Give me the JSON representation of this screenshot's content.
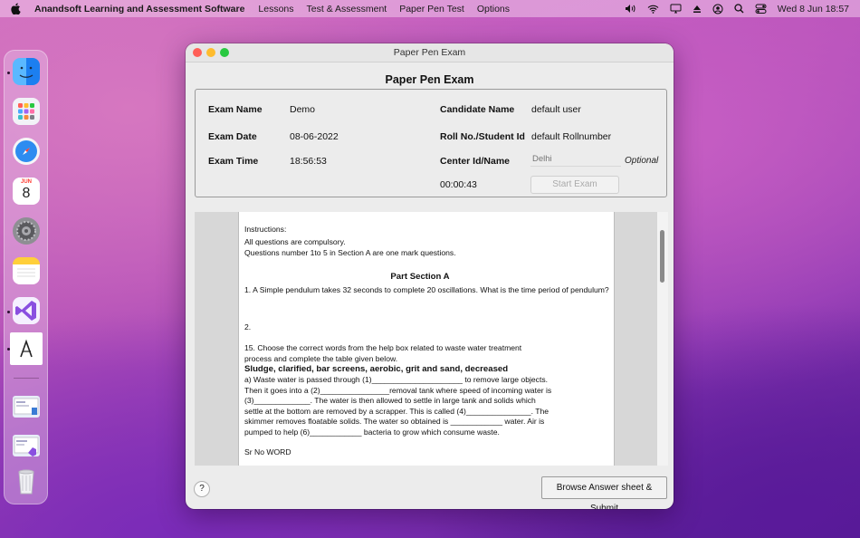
{
  "menubar": {
    "app_name": "Anandsoft Learning and Assessment Software",
    "menus": [
      "Lessons",
      "Test & Assessment",
      "Paper Pen Test",
      "Options"
    ],
    "clock": "Wed 8 Jun  18:57",
    "status_icons": [
      "volume-icon",
      "wifi-icon",
      "display-icon",
      "eject-icon",
      "user-icon",
      "search-icon",
      "control-center-icon"
    ]
  },
  "dock": {
    "apps": [
      "Finder",
      "Launchpad",
      "Safari",
      "Calendar",
      "System Preferences",
      "Notes",
      "Visual Studio",
      "Anandsoft",
      "Preview",
      "Window",
      "Trash"
    ],
    "calendar": {
      "month": "JUN",
      "day": "8"
    }
  },
  "window": {
    "title": "Paper Pen Exam",
    "heading": "Paper Pen Exam",
    "fields": {
      "exam_name_label": "Exam Name",
      "exam_name_value": "Demo",
      "exam_date_label": "Exam Date",
      "exam_date_value": "08-06-2022",
      "exam_time_label": "Exam Time",
      "exam_time_value": "18:56:53",
      "candidate_name_label": "Candidate Name",
      "candidate_name_value": "default user",
      "roll_no_label": "Roll No./Student Id",
      "roll_no_value": "default Rollnumber",
      "center_label": "Center Id/Name",
      "center_placeholder": "Delhi",
      "optional": "Optional",
      "timer": "00:00:43",
      "start_button": "Start Exam"
    },
    "document": {
      "lines": [
        "Instructions:",
        "All questions are compulsory.",
        "Questions number 1to 5 in Section A are one mark questions."
      ],
      "section_title": "Part Section A",
      "q1": "1. A Simple pendulum takes 32 seconds to complete 20 oscillations. What is the time period of pendulum?",
      "q2": "2.",
      "q15_lines": [
        "15. Choose the correct words from the help box related to waste water treatment",
        "process and complete the table given below."
      ],
      "help_box": "Sludge, clarified, bar screens, aerobic, grit and sand, decreased",
      "q15_body": [
        "a) Waste water is passed through (1)_____________________ to remove large objects.",
        "Then it goes into a (2)________________removal tank where speed of incoming water is",
        "(3)_____________. The water is then allowed to settle in large tank and solids which",
        "settle at the bottom are removed by a scrapper. This is called (4)_______________. The",
        "skimmer removes floatable solids. The water so obtained is ____________ water. Air is",
        "pumped to help (6)____________ bacteria to grow which consume waste."
      ],
      "footer_line": "Sr No WORD"
    },
    "help_button": "?",
    "submit_button": "Browse Answer sheet & Submit"
  }
}
